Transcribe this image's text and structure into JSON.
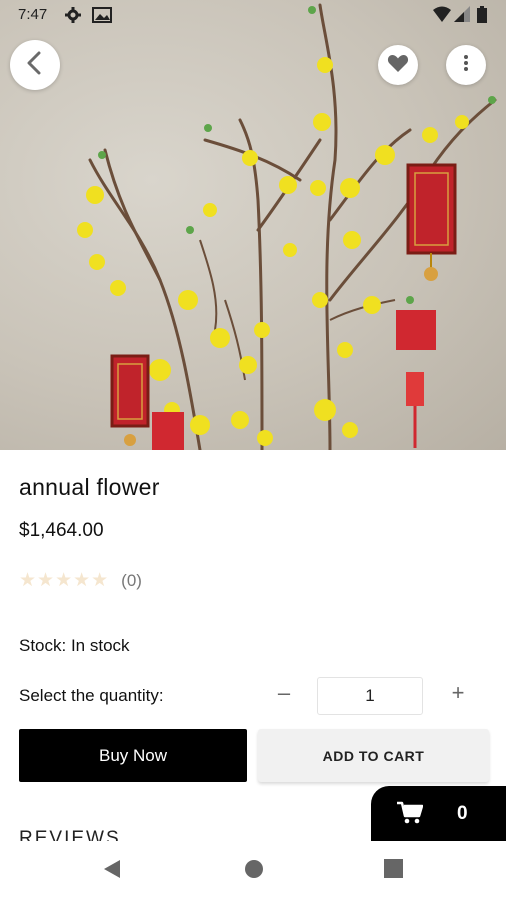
{
  "status_bar": {
    "time": "7:47"
  },
  "product": {
    "title": "annual flower",
    "price": "$1,464.00",
    "rating_count": "(0)",
    "stock": "Stock: In stock"
  },
  "quantity": {
    "label": "Select the quantity:",
    "value": "1"
  },
  "actions": {
    "buy_now": "Buy Now",
    "add_to_cart": "ADD TO CART"
  },
  "reviews_heading": "REVIEWS",
  "cart": {
    "count": "0"
  },
  "icons": {
    "back": "back-arrow-icon",
    "favorite": "heart-icon",
    "more": "more-vert-icon",
    "cart": "shopping-cart-icon"
  },
  "colors": {
    "primary": "#000000",
    "star_empty": "#f5e6cf",
    "secondary_button": "#f1f1f1"
  }
}
